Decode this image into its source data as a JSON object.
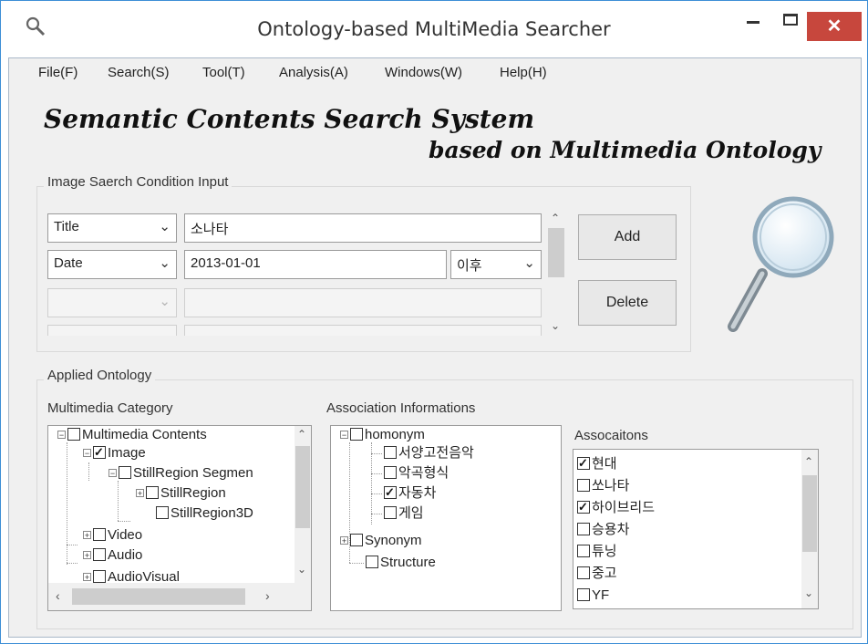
{
  "window": {
    "title": "Ontology-based MultiMedia Searcher",
    "min_glyph": "–",
    "close_glyph": "✕"
  },
  "menu": [
    "File(F)",
    "Search(S)",
    "Tool(T)",
    "Analysis(A)",
    "Windows(W)",
    "Help(H)"
  ],
  "header": {
    "line1": "Semantic Contents Search System",
    "line2": "based on Multimedia Ontology"
  },
  "search_group": {
    "label": "Image Saerch Condition Input",
    "rows": [
      {
        "field": "Title",
        "value": "소나타"
      },
      {
        "field": "Date",
        "value": "2013-01-01",
        "qualifier": "이후"
      }
    ],
    "add_label": "Add",
    "delete_label": "Delete"
  },
  "ontology_group": {
    "label": "Applied Ontology",
    "category": {
      "label": "Multimedia Category",
      "nodes": [
        {
          "label": "Multimedia Contents",
          "checked": false,
          "expander": "−"
        },
        {
          "label": "Image",
          "checked": true,
          "expander": "−"
        },
        {
          "label": "StillRegion Segmen",
          "checked": false,
          "expander": "−"
        },
        {
          "label": "StillRegion",
          "checked": false,
          "expander": "+"
        },
        {
          "label": "StillRegion3D",
          "checked": false
        },
        {
          "label": "Video",
          "checked": false,
          "expander": "+"
        },
        {
          "label": "Audio",
          "checked": false,
          "expander": "+"
        },
        {
          "label": "AudioVisual",
          "checked": false,
          "expander": "+"
        }
      ]
    },
    "association": {
      "label": "Association Informations",
      "nodes": [
        {
          "label": "homonym",
          "checked": false,
          "expander": "−"
        },
        {
          "label": "서양고전음악",
          "checked": false
        },
        {
          "label": "악곡형식",
          "checked": false
        },
        {
          "label": "자동차",
          "checked": true
        },
        {
          "label": "게임",
          "checked": false
        },
        {
          "label": "Synonym",
          "checked": false,
          "expander": "+"
        },
        {
          "label": "Structure",
          "checked": false
        }
      ]
    },
    "associations": {
      "label": "Assocaitons",
      "items": [
        {
          "label": "현대",
          "checked": true
        },
        {
          "label": "쏘나타",
          "checked": false
        },
        {
          "label": "하이브리드",
          "checked": true
        },
        {
          "label": "승용차",
          "checked": false
        },
        {
          "label": "튜닝",
          "checked": false
        },
        {
          "label": "중고",
          "checked": false
        },
        {
          "label": "YF",
          "checked": false
        }
      ]
    }
  },
  "colors": {
    "close_button": "#c7473d",
    "window_border": "#3d8fd6",
    "client_bg": "#f0f0f0"
  }
}
